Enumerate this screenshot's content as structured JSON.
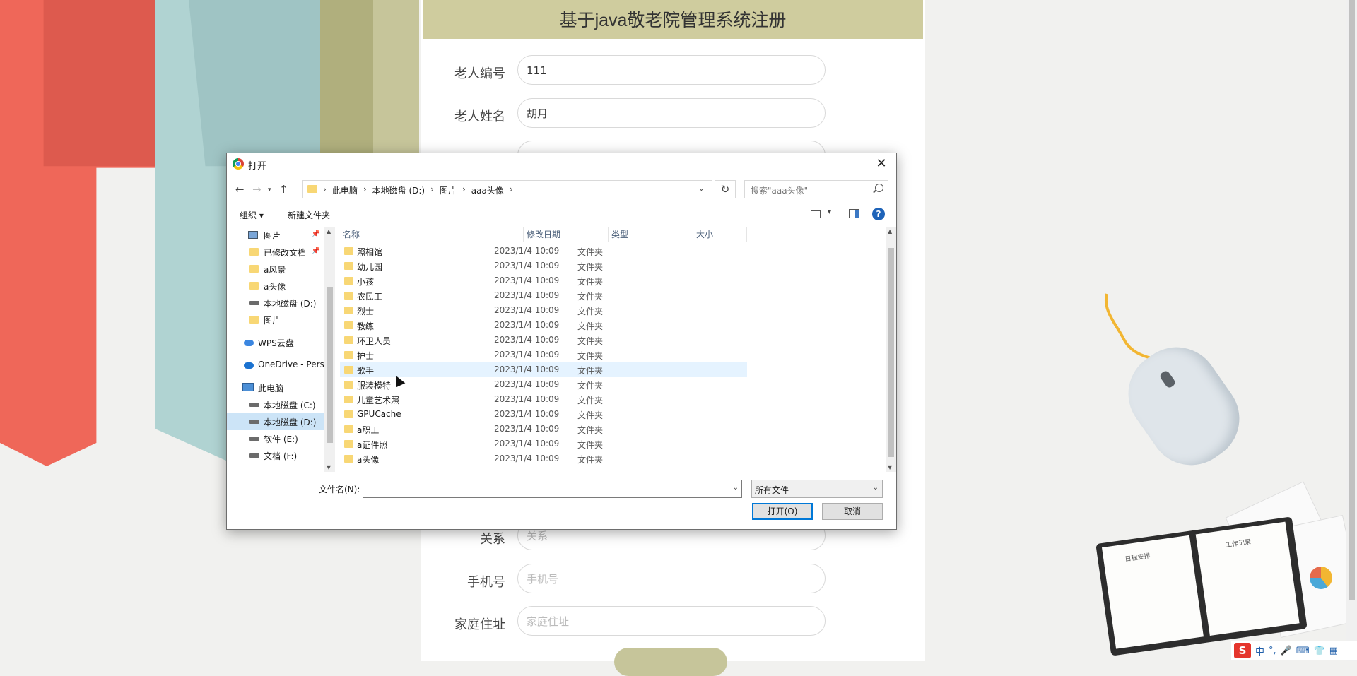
{
  "form": {
    "title": "基于java敬老院管理系统注册",
    "rows": [
      {
        "label": "老人编号",
        "value": "111",
        "placeholder": ""
      },
      {
        "label": "老人姓名",
        "value": "胡月",
        "placeholder": ""
      },
      {
        "label": "关系",
        "value": "",
        "placeholder": "关系"
      },
      {
        "label": "手机号",
        "value": "",
        "placeholder": "手机号"
      },
      {
        "label": "家庭住址",
        "value": "",
        "placeholder": "家庭住址"
      }
    ]
  },
  "dialog": {
    "title": "打开",
    "breadcrumbs": [
      "此电脑",
      "本地磁盘 (D:)",
      "图片",
      "aaa头像"
    ],
    "search_placeholder": "搜索\"aaa头像\"",
    "organize": "组织 ▾",
    "new_folder": "新建文件夹",
    "nav_items": [
      {
        "label": "图片",
        "icon": "pictures-icon",
        "pinned": true
      },
      {
        "label": "已修改文档",
        "icon": "folder-icon",
        "pinned": true
      },
      {
        "label": "a风景",
        "icon": "folder-icon"
      },
      {
        "label": "a头像",
        "icon": "folder-icon"
      },
      {
        "label": "本地磁盘 (D:)",
        "icon": "drive-icon"
      },
      {
        "label": "图片",
        "icon": "folder-icon"
      },
      {
        "label": "WPS云盘",
        "icon": "cloud-icon"
      },
      {
        "label": "OneDrive - Pers",
        "icon": "cloud-icon"
      },
      {
        "label": "此电脑",
        "icon": "pc-icon"
      },
      {
        "label": "本地磁盘 (C:)",
        "icon": "drive-icon"
      },
      {
        "label": "本地磁盘 (D:)",
        "icon": "drive-icon",
        "selected": true
      },
      {
        "label": "软件 (E:)",
        "icon": "drive-icon"
      },
      {
        "label": "文档 (F:)",
        "icon": "drive-icon"
      }
    ],
    "columns": {
      "name": "名称",
      "date": "修改日期",
      "type": "类型",
      "size": "大小"
    },
    "files": [
      {
        "name": "照相馆",
        "date": "2023/1/4 10:09",
        "type": "文件夹"
      },
      {
        "name": "幼儿园",
        "date": "2023/1/4 10:09",
        "type": "文件夹"
      },
      {
        "name": "小孩",
        "date": "2023/1/4 10:09",
        "type": "文件夹"
      },
      {
        "name": "农民工",
        "date": "2023/1/4 10:09",
        "type": "文件夹"
      },
      {
        "name": "烈士",
        "date": "2023/1/4 10:09",
        "type": "文件夹"
      },
      {
        "name": "教练",
        "date": "2023/1/4 10:09",
        "type": "文件夹"
      },
      {
        "name": "环卫人员",
        "date": "2023/1/4 10:09",
        "type": "文件夹"
      },
      {
        "name": "护士",
        "date": "2023/1/4 10:09",
        "type": "文件夹"
      },
      {
        "name": "歌手",
        "date": "2023/1/4 10:09",
        "type": "文件夹",
        "hover": true
      },
      {
        "name": "服装模特",
        "date": "2023/1/4 10:09",
        "type": "文件夹"
      },
      {
        "name": "儿童艺术照",
        "date": "2023/1/4 10:09",
        "type": "文件夹"
      },
      {
        "name": "GPUCache",
        "date": "2023/1/4 10:09",
        "type": "文件夹"
      },
      {
        "name": "a职工",
        "date": "2023/1/4 10:09",
        "type": "文件夹"
      },
      {
        "name": "a证件照",
        "date": "2023/1/4 10:09",
        "type": "文件夹"
      },
      {
        "name": "a头像",
        "date": "2023/1/4 10:09",
        "type": "文件夹"
      }
    ],
    "filename_label": "文件名(N):",
    "filename_value": "",
    "filetype": "所有文件",
    "open_button": "打开(O)",
    "cancel_button": "取消"
  },
  "notebook": {
    "left_text": "日程安排",
    "right_text": "工作记录"
  },
  "tray": {
    "ime_logo": "S",
    "ime_lang": "中",
    "icons": [
      "punctuation-icon",
      "microphone-icon",
      "keyboard-icon",
      "skin-icon",
      "toolbox-icon"
    ]
  },
  "colors": {
    "title_bar": "#cfcc9e",
    "ribbon_red": "#ef6759",
    "ribbon_teal": "#b0d3d2",
    "ribbon_olive": "#c6c59a"
  }
}
